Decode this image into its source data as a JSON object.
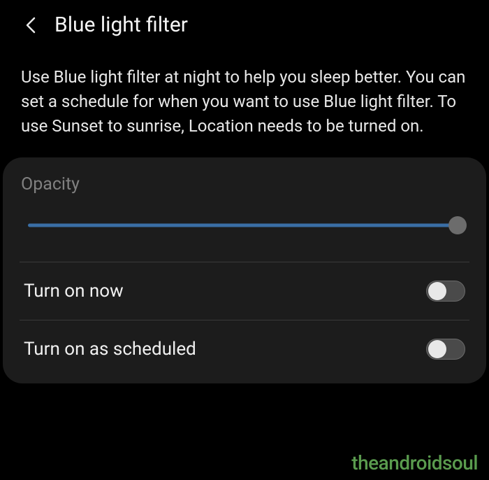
{
  "header": {
    "title": "Blue light filter"
  },
  "description": "Use Blue light filter at night to help you sleep better. You can set a schedule for when you want to use Blue light filter. To use Sunset to sunrise, Location needs to be turned on.",
  "opacity": {
    "label": "Opacity",
    "value": 100
  },
  "switches": {
    "turn_on_now": {
      "label": "Turn on now",
      "value": false
    },
    "turn_on_scheduled": {
      "label": "Turn on as scheduled",
      "value": false
    }
  },
  "watermark": "theandroidsoul"
}
